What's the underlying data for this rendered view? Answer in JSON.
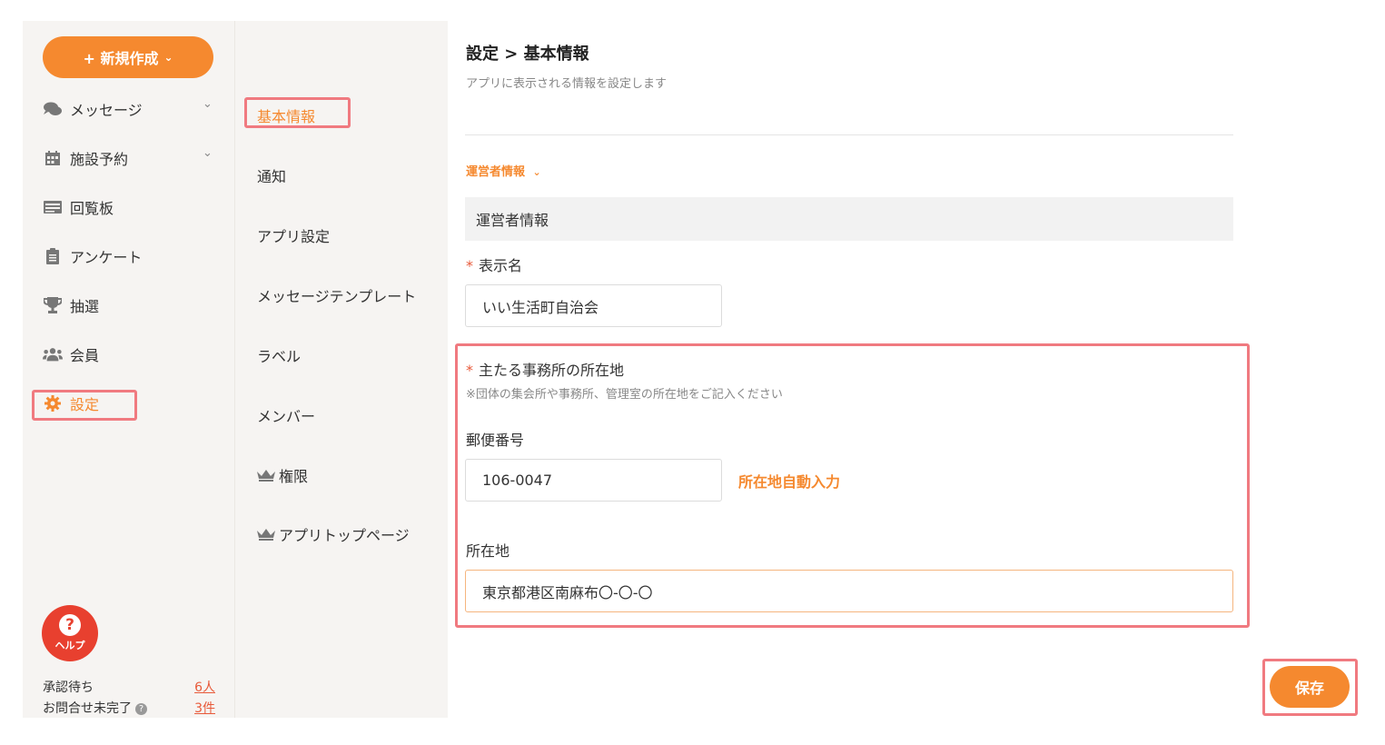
{
  "sidebar": {
    "new_button": "+ 新規作成",
    "items": [
      {
        "label": "メッセージ",
        "icon": "chat-icon"
      },
      {
        "label": "施設予約",
        "icon": "calendar-icon"
      },
      {
        "label": "回覧板",
        "icon": "board-icon"
      },
      {
        "label": "アンケート",
        "icon": "clipboard-icon"
      },
      {
        "label": "抽選",
        "icon": "trophy-icon"
      },
      {
        "label": "会員",
        "icon": "users-icon"
      },
      {
        "label": "設定",
        "icon": "gear-icon"
      }
    ],
    "help_label": "ヘルプ",
    "pending_label": "承認待ち",
    "pending_value": "6人",
    "inquiry_label": "お問合せ未完了",
    "inquiry_value": "3件"
  },
  "submenu": {
    "items": [
      {
        "label": "基本情報"
      },
      {
        "label": "通知"
      },
      {
        "label": "アプリ設定"
      },
      {
        "label": "メッセージテンプレート"
      },
      {
        "label": "ラベル"
      },
      {
        "label": "メンバー"
      },
      {
        "label": "権限",
        "icon": "crown-icon"
      },
      {
        "label": "アプリトップページ",
        "icon": "crown-icon"
      }
    ]
  },
  "main": {
    "breadcrumb": "設定 > 基本情報",
    "subtitle": "アプリに表示される情報を設定します",
    "section_toggle": "運営者情報",
    "section_header": "運営者情報",
    "display_name_label": "表示名",
    "display_name_value": "いい生活町自治会",
    "office_label": "主たる事務所の所在地",
    "office_hint": "※団体の集会所や事務所、管理室の所在地をご記入ください",
    "postal_label": "郵便番号",
    "postal_value": "106-0047",
    "autofill_label": "所在地自動入力",
    "address_label": "所在地",
    "address_value": "東京都港区南麻布〇-〇-〇",
    "save_label": "保存"
  },
  "colors": {
    "accent": "#f5892f",
    "highlight": "#f07a80",
    "help": "#e8402f"
  }
}
